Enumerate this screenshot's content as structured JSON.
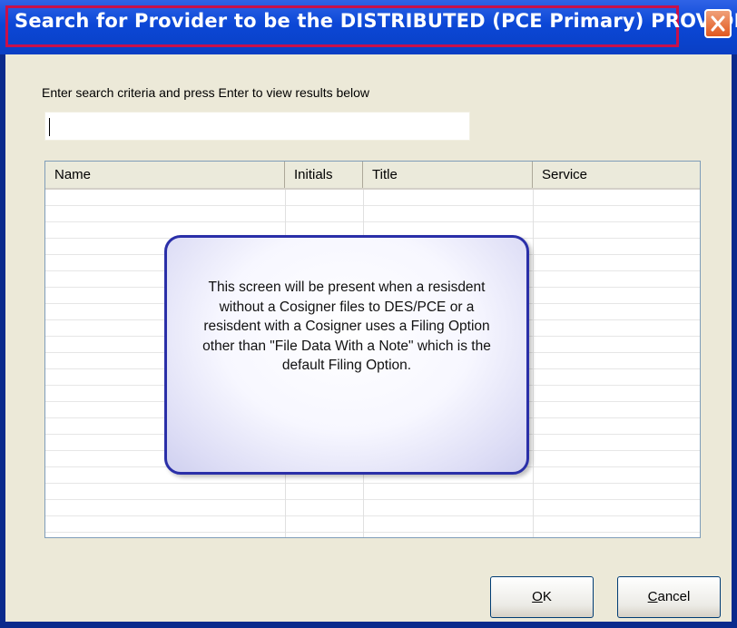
{
  "window": {
    "title": "Search for Provider to be the DISTRIBUTED (PCE Primary) PROVIDER",
    "close_icon": "close-x-icon",
    "highlight_color": "#c8104a"
  },
  "search": {
    "prompt": "Enter search criteria and press Enter to view results below",
    "value": ""
  },
  "results": {
    "columns": [
      "Name",
      "Initials",
      "Title",
      "Service"
    ],
    "rows": []
  },
  "callout": {
    "text": "This screen will be present when a resisdent without a Cosigner files to DES/PCE or a resisdent with a Cosigner uses a Filing Option other than \"File Data With a Note\" which is the default Filing Option.",
    "border_color": "#2a2fa8"
  },
  "buttons": {
    "ok_mnemonic": "O",
    "ok_rest": "K",
    "cancel_mnemonic": "C",
    "cancel_rest": "ancel"
  }
}
